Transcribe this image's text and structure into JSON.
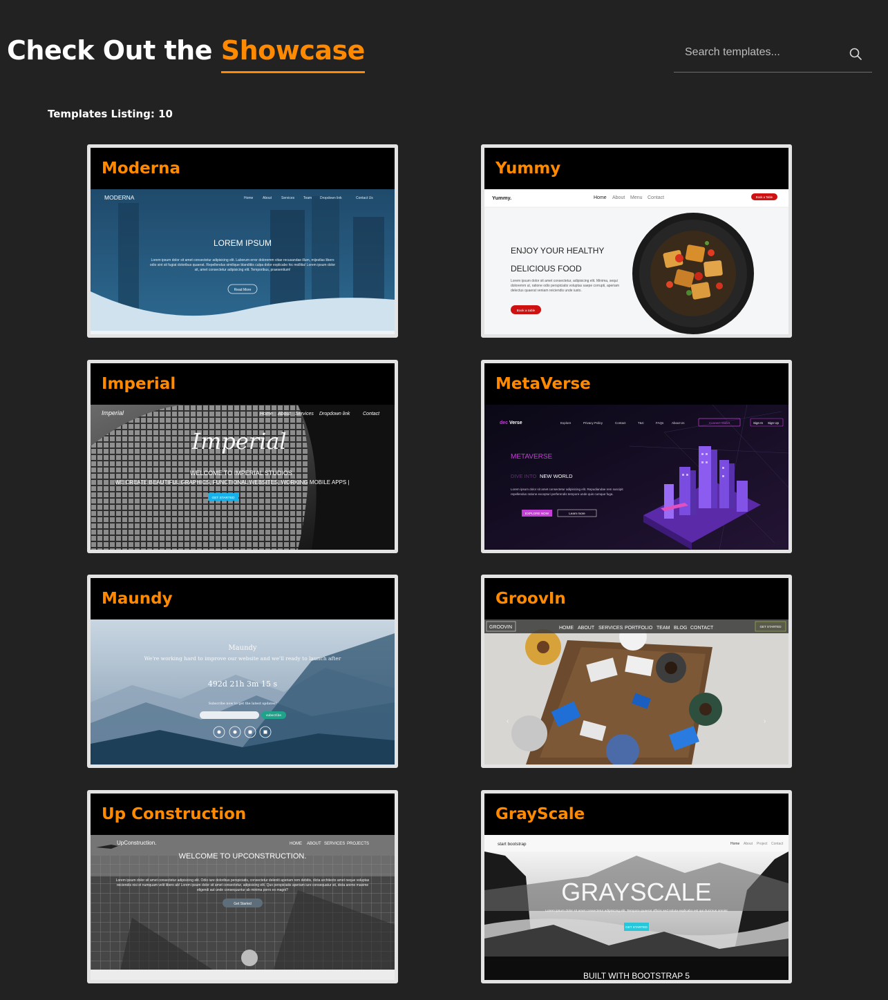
{
  "header": {
    "title_prefix": "Check Out the ",
    "title_accent": "Showcase",
    "search_placeholder": "Search templates..."
  },
  "listing": {
    "label": "Templates Listing: 10"
  },
  "colors": {
    "accent": "#ff8a00",
    "background": "#222222",
    "card_border": "#e4e4e4"
  },
  "templates": [
    {
      "name": "Moderna",
      "preview": {
        "brand": "MODERNA",
        "nav": [
          "Home",
          "About",
          "Services",
          "Team",
          "Dropdown link",
          "Contact Us"
        ],
        "heading": "LOREM IPSUM",
        "body": "Lorem ipsum dolor sit amet consectetur adipisicing elit. Laborum error doloremm vitae recusandae illum, mijestlas libero odio sint sit fugiat doloribus quaerat. Repellendus similique blanditiis culpa dolor explicabo hic mollitia! Lorem ipsum dolor sit, amet consectetur adipisicing elit. Temporibus, praesentium!",
        "button": "Read More"
      }
    },
    {
      "name": "Yummy",
      "preview": {
        "brand": "Yummy.",
        "nav": [
          "Home",
          "About",
          "Menu",
          "Contact"
        ],
        "cta": "Book a Table",
        "heading_line1": "ENJOY YOUR HEALTHY",
        "heading_line2": "DELICIOUS FOOD",
        "body": "Lorem ipsum dolor sit amet consectetur, adipisicing elit. Minima, sequi doloremm ut, ratione odio perspiciatis voluptas saepe corrupti, aperiam delectus quaerat veniam reiciendis unde iusto.",
        "button": "Book a table"
      }
    },
    {
      "name": "Imperial",
      "preview": {
        "brand": "Imperial",
        "nav": [
          "Home",
          "About",
          "Services",
          "Dropdown link",
          "Contact"
        ],
        "script_title": "Imperial",
        "heading": "WELCOME TO IMPERIAL STUDIOS",
        "subheading": "WE CREATE BEAUTIFUL GRAPHICS, FUNCTIONAL WEBSITES, WORKING MOBILE APPS |",
        "button": "GET STARTED"
      }
    },
    {
      "name": "MetaVerse",
      "preview": {
        "brand_accent": "dec",
        "brand": "Verse",
        "nav": [
          "Explore",
          "Privacy Policy",
          "Contact",
          "T&C",
          "FAQs",
          "About Us"
        ],
        "connect": "Connect Wallet",
        "sign_in": "Sign In",
        "sign_up": "Sign Up",
        "heading": "METAVERSE",
        "sub_accent": "DIVE INTO",
        "sub": " NEW WORLD",
        "body": "Lorem ipsum dolor sit amet consectetur adipisicing elit. Repudiandae rem suscipit repellendus ratione excepturi perferendis tempore unde quis cumque fuga.",
        "button_primary": "EXPLORE NOW",
        "button_secondary": "Learn more"
      }
    },
    {
      "name": "Maundy",
      "preview": {
        "heading": "Maundy",
        "tagline": "We're working hard to improve our website and we'll ready to launch after",
        "countdown": "492d 21h 3m 15 s",
        "subscribe_text": "Subscribe now to get the latest updates!",
        "button": "subscribe"
      }
    },
    {
      "name": "GroovIn",
      "preview": {
        "brand": "GROOVIN",
        "nav": [
          "HOME",
          "ABOUT",
          "SERVICES",
          "PORTFOLIO",
          "TEAM",
          "BLOG",
          "CONTACT"
        ],
        "button": "GET STARTED"
      }
    },
    {
      "name": "Up Construction",
      "preview": {
        "brand": "UpConstruction.",
        "nav": [
          "HOME",
          "ABOUT",
          "SERVICES",
          "PROJECTS"
        ],
        "heading": "WELCOME TO UPCONSTRUCTION.",
        "body": "Lorem ipsum dolor sit amet consectetur adipisicing elit. Odio iure doloribus perspiciatis, consectetur deleniti aperiam rem debitis, dicta architecto amet neque voluptas reiciendis nisi et numquam velit libero ab! Lorem ipsum dolor sit amet consectetur, adipisicing elit. Quo perspiciatis aperiam iure consequatur sit, dicta animo maxime eligendi aut unde consequuntur ab minima porro ex magni?",
        "button": "Get Started"
      }
    },
    {
      "name": "GrayScale",
      "preview": {
        "brand": "start bootstrap",
        "nav": [
          "Home",
          "About",
          "Project",
          "Contact"
        ],
        "heading": "GRAYSCALE",
        "body": "Lorem ipsum dolor sit amet consectetur adipisicing elit. Tempora quaerat officiis sed soluta explicabo est qui ducimus omnis!",
        "button": "GET STARTED",
        "footer": "BUILT WITH BOOTSTRAP 5"
      }
    }
  ]
}
